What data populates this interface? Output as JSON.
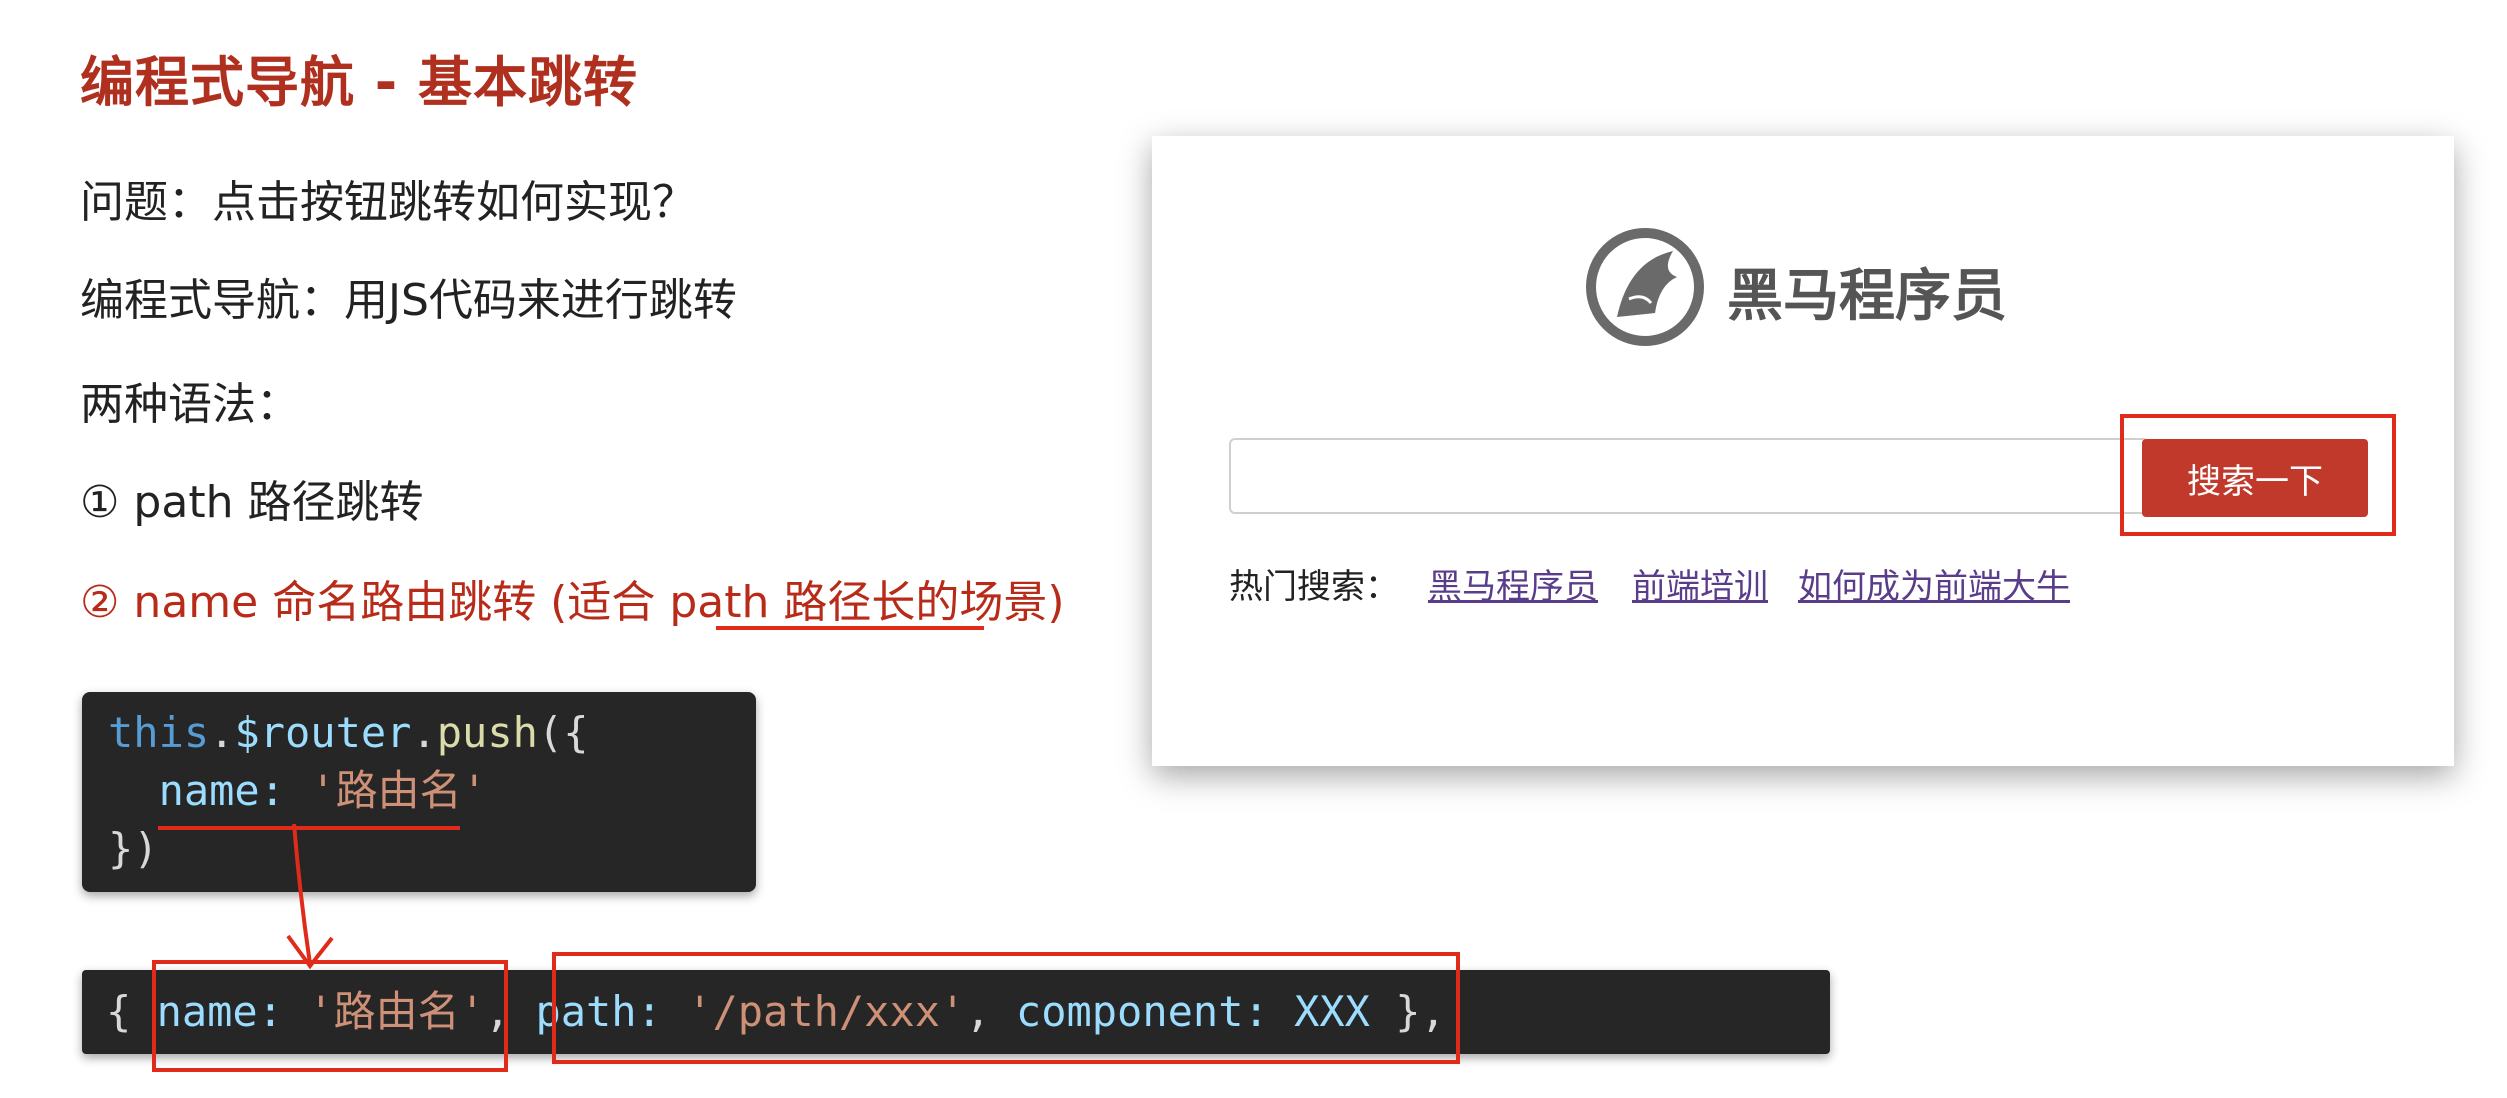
{
  "slide": {
    "title": "编程式导航 - 基本跳转",
    "question": "问题：点击按钮跳转如何实现？",
    "definition": "编程式导航：用JS代码来进行跳转",
    "syntax_label": "两种语法：",
    "option1": "① path 路径跳转",
    "option2": "② name 命名路由跳转 (适合 path 路径长的场景)"
  },
  "code_push": {
    "line1_this": "this",
    "line1_dot1": ".",
    "line1_router": "$router",
    "line1_dot2": ".",
    "line1_push": "push",
    "line1_paren": "({",
    "line2_indent": "  ",
    "line2_key": "name:",
    "line2_space": " ",
    "line2_value": "'路由名'",
    "line3": "})"
  },
  "code_route": {
    "open": "{ ",
    "name_key": "name:",
    "name_value": " '路由名'",
    "comma1": ", ",
    "path_key": "path:",
    "path_value": " '/path/xxx'",
    "comma2": ", ",
    "component_key": "component:",
    "component_value": " XXX",
    "close": " },"
  },
  "preview": {
    "brand": "黑马程序员",
    "search_value": "",
    "search_button": "搜索一下",
    "hot_label": "热门搜索：",
    "hot_links": [
      "黑马程序员",
      "前端培训",
      "如何成为前端大牛"
    ]
  },
  "colors": {
    "title": "#b03020",
    "annotation": "#e02a1a",
    "search_button": "#c0392b",
    "link": "#5a3d8a",
    "code_bg": "#262626"
  }
}
